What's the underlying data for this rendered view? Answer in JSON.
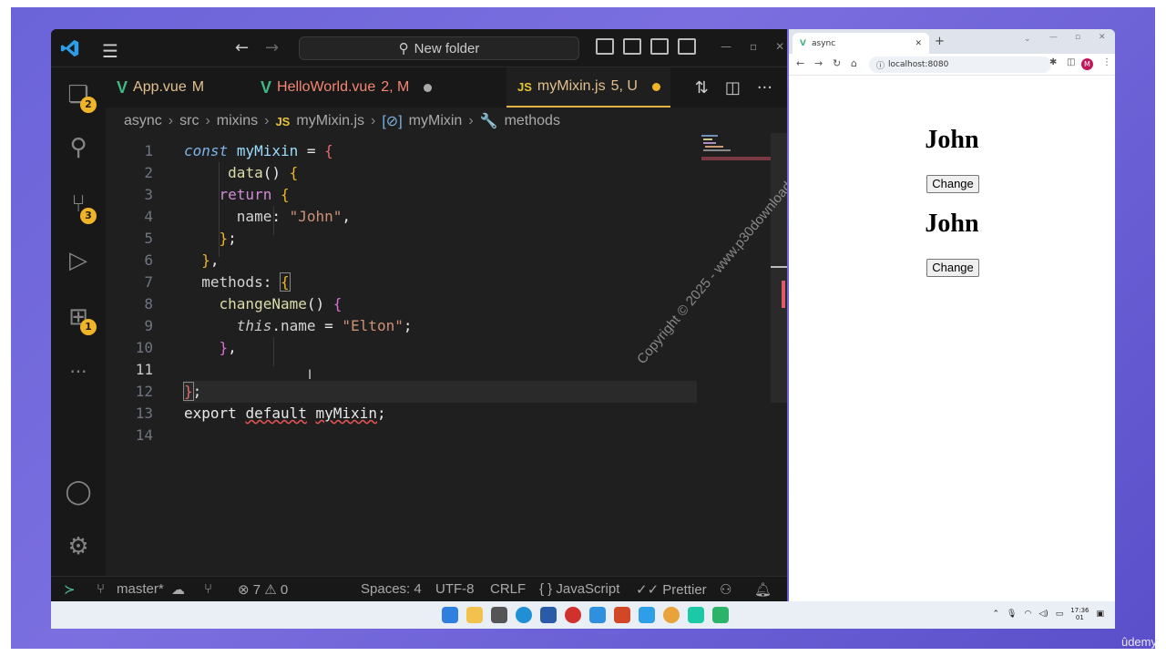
{
  "titlebar": {
    "search_label": "New folder"
  },
  "activity": {
    "explorer_badge": "2",
    "scm_badge": "3",
    "extensions_badge": "1"
  },
  "tabs": [
    {
      "label": "App.vue",
      "status": "M"
    },
    {
      "label": "HelloWorld.vue",
      "status": "2, M"
    },
    {
      "icon": "JS",
      "label": "myMixin.js",
      "status": "5, U"
    }
  ],
  "breadcrumb": [
    "async",
    "src",
    "mixins",
    "myMixin.js",
    "myMixin",
    "methods"
  ],
  "breadcrumb_js": "JS",
  "line_numbers": [
    "1",
    "2",
    "3",
    "4",
    "5",
    "6",
    "7",
    "8",
    "9",
    "10",
    "11",
    "12",
    "13",
    "14"
  ],
  "code": {
    "l1_const": "const",
    "l1_name": "myMixin",
    "l1_eq": " = ",
    "l1_brace": "{",
    "l2_fn": "data",
    "l2_rest": "() ",
    "l2_brace": "{",
    "l3_return": "return",
    "l3_brace": "{",
    "l4_prop": "name",
    "l4_colon": ": ",
    "l4_str": "\"John\"",
    "l4_comma": ",",
    "l5_brace": "}",
    "l5_semi": ";",
    "l6_brace": "}",
    "l6_comma": ",",
    "l7_prop": "methods",
    "l7_colon": ": ",
    "l7_brace": "{",
    "l8_fn": "changeName",
    "l8_rest": "() ",
    "l8_brace": "{",
    "l9_this": "this",
    "l9_prop": ".name",
    "l9_eq": " = ",
    "l9_str": "\"Elton\"",
    "l9_semi": ";",
    "l10_brace": "}",
    "l10_comma": ",",
    "l12_brace": "}",
    "l12_semi": ";",
    "l13_export": "export",
    "l13_default": "default",
    "l13_name": "myMixin",
    "l13_semi": ";"
  },
  "watermark": "Copyright © 2025 - www.p30download.com",
  "statusbar": {
    "branch": "master*",
    "problems": "⊗ 7 ⚠ 0",
    "spaces": "Spaces: 4",
    "encoding": "UTF-8",
    "eol": "CRLF",
    "language": "{ } JavaScript",
    "formatter": "✓✓ Prettier"
  },
  "browser": {
    "tab_title": "async",
    "url": "localhost:8080",
    "headings": [
      "John",
      "John"
    ],
    "button_label": "Change"
  },
  "taskbar": {
    "time": "17:36",
    "date": "01"
  },
  "brand": "ûdemy",
  "colors": {
    "accent": "#e2b342",
    "vue_green": "#41b883",
    "badge": "#f0b429"
  }
}
